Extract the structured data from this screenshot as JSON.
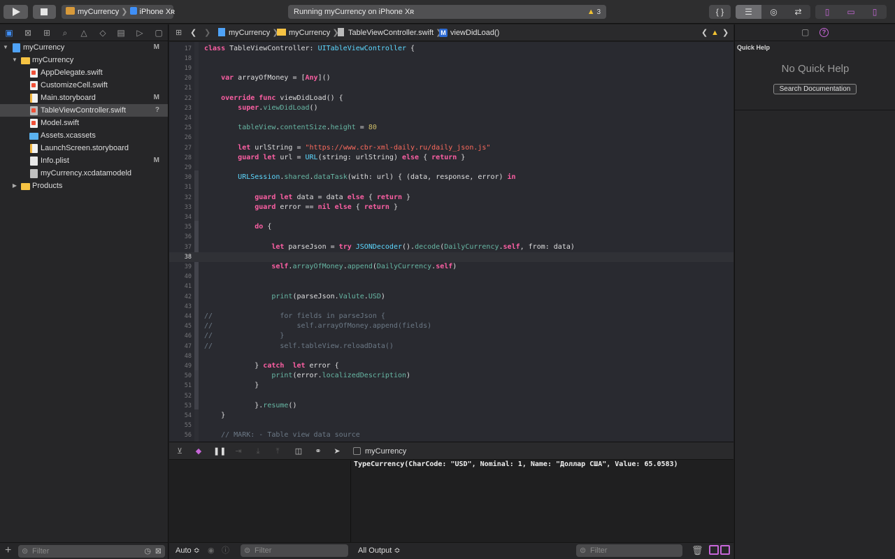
{
  "toolbar": {
    "scheme_target": "myCurrency",
    "scheme_device": "iPhone Xʀ",
    "status": "Running myCurrency on iPhone Xʀ",
    "warning_count": "3",
    "code_review_label": "{ }"
  },
  "navigator": {
    "items": [
      {
        "label": "myCurrency",
        "badge": "M"
      },
      {
        "label": "myCurrency",
        "badge": ""
      },
      {
        "label": "AppDelegate.swift",
        "badge": ""
      },
      {
        "label": "CustomizeCell.swift",
        "badge": ""
      },
      {
        "label": "Main.storyboard",
        "badge": "M"
      },
      {
        "label": "TableViewController.swift",
        "badge": "?"
      },
      {
        "label": "Model.swift",
        "badge": ""
      },
      {
        "label": "Assets.xcassets",
        "badge": ""
      },
      {
        "label": "LaunchScreen.storyboard",
        "badge": ""
      },
      {
        "label": "Info.plist",
        "badge": "M"
      },
      {
        "label": "myCurrency.xcdatamodeld",
        "badge": ""
      },
      {
        "label": "Products",
        "badge": ""
      }
    ],
    "filter_placeholder": "Filter"
  },
  "jumpbar": {
    "project": "myCurrency",
    "group": "myCurrency",
    "file": "TableViewController.swift",
    "method_badge": "M",
    "method": "viewDidLoad()"
  },
  "editor": {
    "current_line": 38,
    "lines": [
      {
        "n": "17",
        "html": "<span class=\"kw\">class</span> TableViewController: <span class=\"ty\">UITableViewController</span> {"
      },
      {
        "n": "18",
        "html": ""
      },
      {
        "n": "19",
        "html": ""
      },
      {
        "n": "20",
        "html": "    <span class=\"kw\">var</span> arrayOfMoney = [<span class=\"kw\">Any</span>]()"
      },
      {
        "n": "21",
        "html": ""
      },
      {
        "n": "22",
        "html": "    <span class=\"kw\">override func</span> viewDidLoad() {"
      },
      {
        "n": "23",
        "html": "        <span class=\"kw\">super</span>.<span class=\"fn\">viewDidLoad</span>()"
      },
      {
        "n": "24",
        "html": ""
      },
      {
        "n": "25",
        "html": "        <span class=\"fn\">tableView</span>.<span class=\"fn\">contentSize</span>.<span class=\"fn\">height</span> = <span class=\"nu\">80</span>"
      },
      {
        "n": "26",
        "html": ""
      },
      {
        "n": "27",
        "html": "        <span class=\"kw\">let</span> urlString = <span class=\"st\">\"https://www.cbr-xml-daily.ru/daily_json.js\"</span>"
      },
      {
        "n": "28",
        "html": "        <span class=\"kw\">guard let</span> url = <span class=\"ty\">URL</span>(string: urlString) <span class=\"kw\">else</span> { <span class=\"kw\">return</span> }"
      },
      {
        "n": "29",
        "html": ""
      },
      {
        "n": "30",
        "html": "        <span class=\"ty\">URLSession</span>.<span class=\"fn\">shared</span>.<span class=\"fn\">dataTask</span>(with: url) { (data, response, error) <span class=\"kw\">in</span>"
      },
      {
        "n": "31",
        "html": ""
      },
      {
        "n": "32",
        "html": "            <span class=\"kw\">guard let</span> data = data <span class=\"kw\">else</span> { <span class=\"kw\">return</span> }"
      },
      {
        "n": "33",
        "html": "            <span class=\"kw\">guard</span> error == <span class=\"kw\">nil else</span> { <span class=\"kw\">return</span> }"
      },
      {
        "n": "34",
        "html": ""
      },
      {
        "n": "35",
        "html": "            <span class=\"kw\">do</span> {"
      },
      {
        "n": "36",
        "html": ""
      },
      {
        "n": "37",
        "html": "                <span class=\"kw\">let</span> parseJson = <span class=\"kw\">try</span> <span class=\"ty\">JSONDecoder</span>().<span class=\"fn\">decode</span>(<span class=\"fn\">DailyCurrency</span>.<span class=\"kw\">self</span>, from: data)"
      },
      {
        "n": "38",
        "html": ""
      },
      {
        "n": "39",
        "html": "                <span class=\"kw\">self</span>.<span class=\"fn\">arrayOfMoney</span>.<span class=\"fn\">append</span>(<span class=\"fn\">DailyCurrency</span>.<span class=\"kw\">self</span>)"
      },
      {
        "n": "40",
        "html": ""
      },
      {
        "n": "41",
        "html": ""
      },
      {
        "n": "42",
        "html": "                <span class=\"fn\">print</span>(parseJson.<span class=\"fn\">Valute</span>.<span class=\"fn\">USD</span>)"
      },
      {
        "n": "43",
        "html": ""
      },
      {
        "n": "44",
        "html": "<span class=\"cm\">//                for fields in parseJson {</span>"
      },
      {
        "n": "45",
        "html": "<span class=\"cm\">//                    self.arrayOfMoney.append(fields)</span>"
      },
      {
        "n": "46",
        "html": "<span class=\"cm\">//                }</span>"
      },
      {
        "n": "47",
        "html": "<span class=\"cm\">//                self.tableView.reloadData()</span>"
      },
      {
        "n": "48",
        "html": ""
      },
      {
        "n": "49",
        "html": "            } <span class=\"kw\">catch</span>  <span class=\"kw\">let</span> error {"
      },
      {
        "n": "50",
        "html": "                <span class=\"fn\">print</span>(error.<span class=\"fn\">localizedDescription</span>)"
      },
      {
        "n": "51",
        "html": "            }"
      },
      {
        "n": "52",
        "html": ""
      },
      {
        "n": "53",
        "html": "            }.<span class=\"fn\">resume</span>()"
      },
      {
        "n": "54",
        "html": "    }"
      },
      {
        "n": "55",
        "html": ""
      },
      {
        "n": "56",
        "html": "    <span class=\"cm\">// MARK: - Table view data source</span>"
      }
    ]
  },
  "debug": {
    "process": "myCurrency",
    "console_output": "TypeCurrency(CharCode: \"USD\", Nominal: 1, Name: \"Доллар США\", Value: 65.0583)",
    "variables_scope": "Auto ≎",
    "output_scope": "All Output ≎",
    "filter_placeholder": "Filter"
  },
  "inspector": {
    "title": "Quick Help",
    "empty_message": "No Quick Help",
    "search_button": "Search Documentation"
  },
  "colors": {
    "accent": "#3f8ff7",
    "warning": "#f1c232",
    "keyword": "#fc5fa3",
    "comment": "#6c7986",
    "string": "#fc6a5d"
  }
}
